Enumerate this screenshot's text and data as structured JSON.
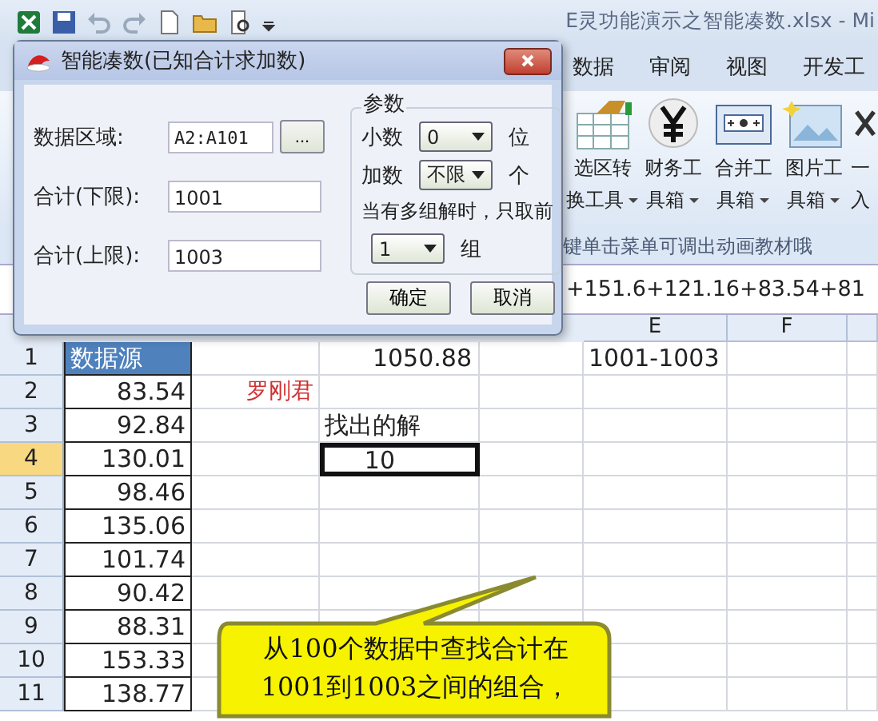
{
  "title_bar": {
    "title": "E灵功能演示之智能凑数.xlsx  -  Mi"
  },
  "ribbon_tabs": [
    {
      "label": "数据",
      "selected": false
    },
    {
      "label": "审阅",
      "selected": false
    },
    {
      "label": "视图",
      "selected": false
    },
    {
      "label": "开发工",
      "selected": false
    }
  ],
  "ribbon_buttons": [
    {
      "line1": "选区转",
      "line2": "换工具"
    },
    {
      "line1": "财务工",
      "line2": "具箱"
    },
    {
      "line1": "合并工",
      "line2": "具箱"
    },
    {
      "line1": "图片工",
      "line2": "具箱"
    },
    {
      "line1": "一",
      "line2": "入"
    }
  ],
  "hint": "键单击菜单可调出动画教材哦",
  "formula": "+151.6+121.16+83.54+81",
  "columns": [
    "E",
    "F"
  ],
  "rows": [
    {
      "number": "1",
      "selected": false,
      "a": "数据源",
      "c": "1050.88",
      "e": "1001-1003"
    },
    {
      "number": "2",
      "selected": false,
      "a": "83.54",
      "b": "罗刚君"
    },
    {
      "number": "3",
      "selected": false,
      "a": "92.84",
      "c": "找出的解"
    },
    {
      "number": "4",
      "selected": true,
      "a": "130.01",
      "c": "10"
    },
    {
      "number": "5",
      "selected": false,
      "a": "98.46"
    },
    {
      "number": "6",
      "selected": false,
      "a": "135.06"
    },
    {
      "number": "7",
      "selected": false,
      "a": "101.74"
    },
    {
      "number": "8",
      "selected": false,
      "a": "90.42"
    },
    {
      "number": "9",
      "selected": false,
      "a": "88.31"
    },
    {
      "number": "10",
      "selected": false,
      "a": "153.33"
    },
    {
      "number": "11",
      "selected": false,
      "a": "138.77"
    }
  ],
  "dialog": {
    "title": "智能凑数(已知合计求加数)",
    "fields": [
      {
        "label": "数据区域:",
        "value": "A2:A101",
        "browse": "..."
      },
      {
        "label": "合计(下限):",
        "value": "1001"
      },
      {
        "label": "合计(上限):",
        "value": "1003"
      }
    ],
    "group_title": "参数",
    "decimals": {
      "label": "小数",
      "value": "0",
      "unit": "位"
    },
    "addends": {
      "label": "加数",
      "value": "不限",
      "unit": "个"
    },
    "multi_label": "当有多组解时，只取前",
    "groups": {
      "value": "1",
      "unit": "组"
    },
    "buttons": [
      "确定",
      "取消"
    ]
  },
  "callout": {
    "lines": [
      "从100个数据中查找合计在",
      "1001到1003之间的组合，"
    ]
  }
}
